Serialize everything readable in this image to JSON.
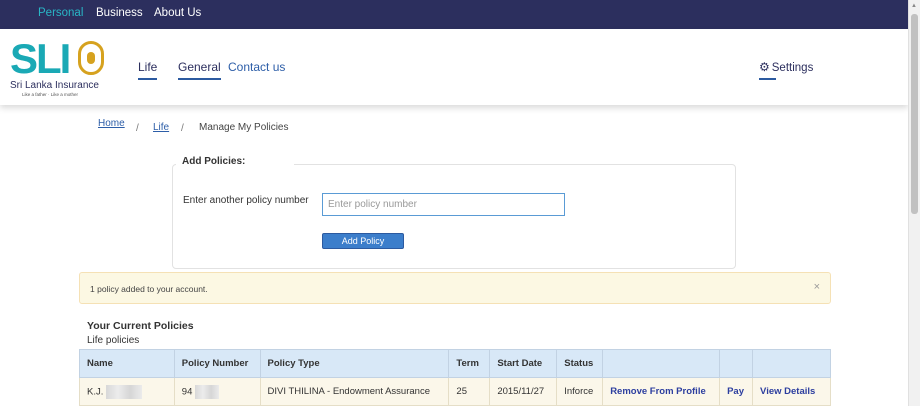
{
  "topbar": {
    "personal": "Personal",
    "business": "Business",
    "about": "About Us"
  },
  "logo": {
    "mark": "SLIC",
    "name": "Sri Lanka Insurance",
    "tagline": "Like a father · Like a mother"
  },
  "nav": {
    "life": "Life",
    "general": "General",
    "contact": "Contact us",
    "settings": "Settings"
  },
  "breadcrumb": {
    "home": "Home",
    "sep": "/",
    "life": "Life",
    "current": "Manage My Policies"
  },
  "add_policies": {
    "title": "Add Policies:",
    "label": "Enter another policy number",
    "placeholder": "Enter policy number",
    "button": "Add Policy"
  },
  "alert": {
    "message": "1 policy added to your account.",
    "close": "×"
  },
  "policies": {
    "title": "Your Current Policies",
    "subtitle": "Life policies",
    "columns": [
      "Name",
      "Policy Number",
      "Policy Type",
      "Term",
      "Start Date",
      "Status",
      "",
      "",
      ""
    ],
    "rows": [
      {
        "name": "K.J.",
        "policy_number": "94",
        "policy_type": "DIVI THILINA - Endowment Assurance",
        "term": "25",
        "start_date": "2015/11/27",
        "status": "Inforce",
        "remove": "Remove From Profile",
        "pay": "Pay",
        "details": "View Details"
      }
    ]
  },
  "colors": {
    "topbar": "#2c2f5e",
    "accent": "#29b6c6",
    "link": "#2d5ea8",
    "button": "#3c7ecb",
    "alert_bg": "#fcf8e3",
    "table_header": "#d8e8f7"
  }
}
